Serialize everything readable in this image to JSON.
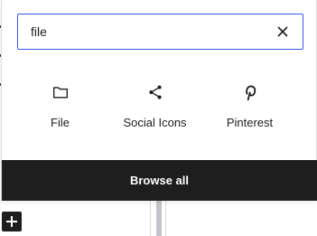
{
  "search": {
    "value": "file",
    "clear_icon": "close-icon"
  },
  "results": [
    {
      "label": "File",
      "icon": "folder-icon"
    },
    {
      "label": "Social Icons",
      "icon": "share-icon"
    },
    {
      "label": "Pinterest",
      "icon": "pinterest-icon"
    }
  ],
  "browse_all": {
    "label": "Browse all"
  },
  "colors": {
    "accent": "#3858e9",
    "dark": "#1e1e1e",
    "border": "#dcdcde"
  }
}
